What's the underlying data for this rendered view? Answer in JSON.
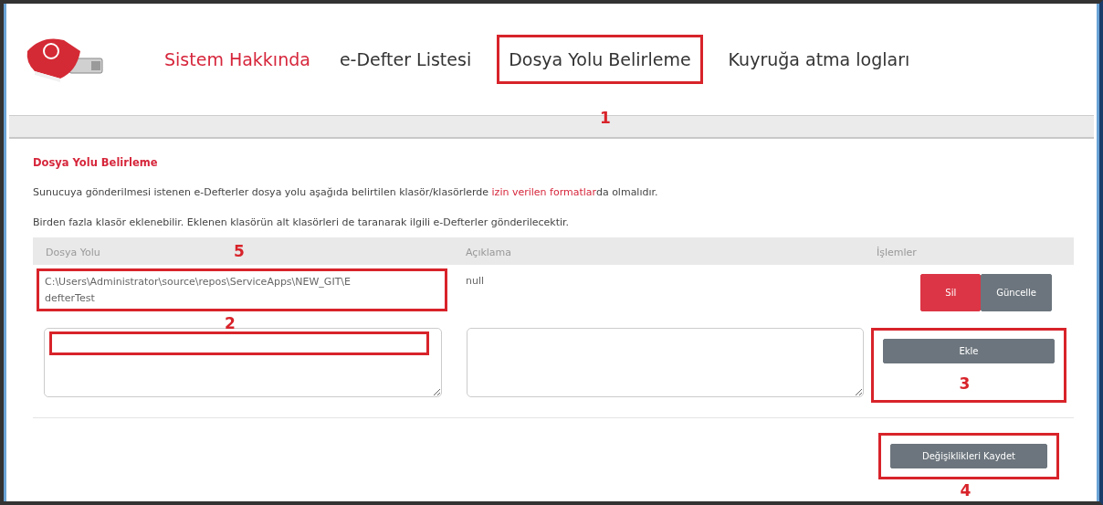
{
  "nav": [
    {
      "label": "Sistem Hakkında",
      "selected": true
    },
    {
      "label": "e-Defter Listesi",
      "selected": false
    },
    {
      "label": "Dosya Yolu Belirleme",
      "selected": false,
      "callout": "1"
    },
    {
      "label": "Kuyruğa atma logları",
      "selected": false
    }
  ],
  "section_title": "Dosya Yolu Belirleme",
  "info": {
    "before": "Sunucuya gönderilmesi istenen e-Defterler dosya yolu aşağıda belirtilen klasör/klasörlerde",
    "link": "izin verilen formatlar",
    "after": "da olmalıdır."
  },
  "note": "Birden fazla klasör eklenebilir. Eklenen klasörün alt klasörleri de taranarak ilgili e-Defterler gönderilecektir.",
  "table": {
    "columns": [
      {
        "label": "Dosya Yolu",
        "callout": "5"
      },
      {
        "label": "Açıklama"
      },
      {
        "label": "İşlemler"
      }
    ],
    "rows": [
      {
        "path": "C:\\Users\\Administrator\\source\\repos\\ServiceApps\\NEW_GIT\\EdefterTest",
        "path_callout": "2",
        "description": "null",
        "buttons": [
          {
            "label": "Sil",
            "kind": "danger"
          },
          {
            "label": "Güncelle",
            "kind": "secondary"
          }
        ]
      }
    ]
  },
  "new_row": {
    "path_field_highlighted": true,
    "add_button": {
      "label": "Ekle",
      "callout": "3"
    }
  },
  "save_button": {
    "label": "Değişiklikleri Kaydet",
    "callout": "4"
  }
}
